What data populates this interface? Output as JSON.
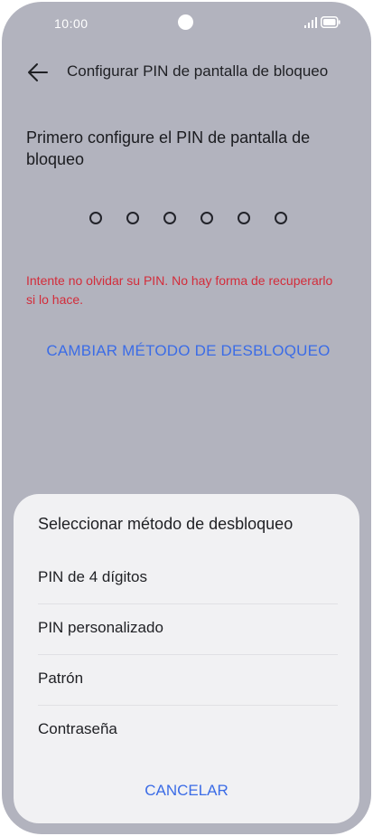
{
  "status_bar": {
    "time": "10:00"
  },
  "header": {
    "title": "Configurar PIN de pantalla de bloqueo"
  },
  "main": {
    "instruction": "Primero configure el PIN de pantalla de bloqueo",
    "pin_length": 6,
    "warning": "Intente no olvidar su PIN. No hay forma de recuperarlo si lo hace.",
    "change_method_label": "CAMBIAR MÉTODO DE DESBLOQUEO"
  },
  "sheet": {
    "title": "Seleccionar método de desbloqueo",
    "options": [
      {
        "label": "PIN de 4 dígitos"
      },
      {
        "label": "PIN personalizado"
      },
      {
        "label": "Patrón"
      },
      {
        "label": "Contraseña"
      }
    ],
    "cancel_label": "CANCELAR"
  },
  "colors": {
    "accent": "#3b6ce6",
    "warning": "#d32c3a",
    "background": "#b2b3be",
    "sheet_background": "#f1f1f3"
  },
  "icons": [
    "back-arrow-icon",
    "signal-icon",
    "battery-icon",
    "front-camera-icon"
  ]
}
